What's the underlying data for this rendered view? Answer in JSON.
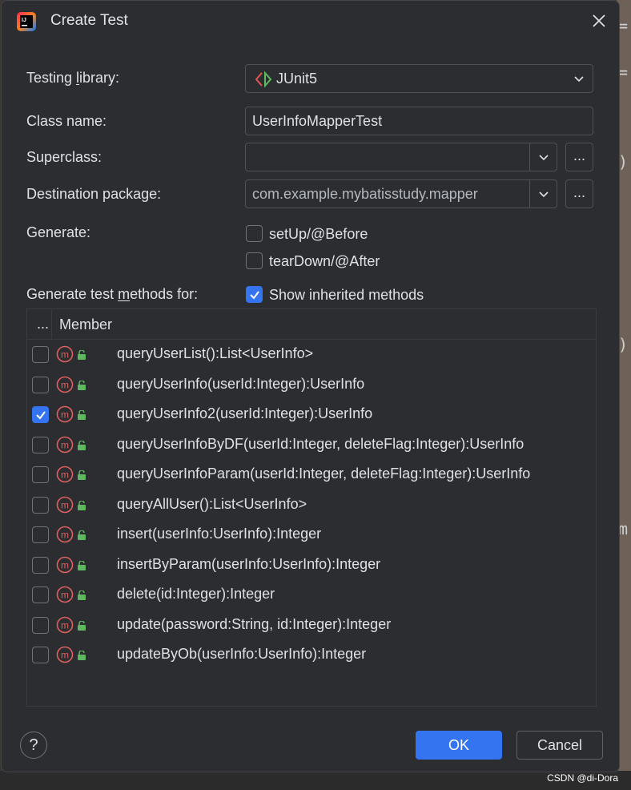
{
  "window": {
    "title": "Create Test"
  },
  "form": {
    "testing_library_label": "Testing library:",
    "testing_library_value": "JUnit5",
    "class_name_label": "Class name:",
    "class_name_value": "UserInfoMapperTest",
    "superclass_label": "Superclass:",
    "superclass_value": "",
    "destination_label": "Destination package:",
    "destination_value": "com.example.mybatisstudy.mapper",
    "browse_label": "...",
    "generate_label": "Generate:",
    "setup_label": "setUp/@Before",
    "setup_checked": false,
    "teardown_label": "tearDown/@After",
    "teardown_checked": false,
    "methods_for_label": "Generate test methods for:",
    "show_inherited_label": "Show inherited methods",
    "show_inherited_checked": true
  },
  "table": {
    "col_check": "...",
    "col_member": "Member",
    "rows": [
      {
        "signature": "queryUserList():List<UserInfo>",
        "checked": false
      },
      {
        "signature": "queryUserInfo(userId:Integer):UserInfo",
        "checked": false
      },
      {
        "signature": "queryUserInfo2(userId:Integer):UserInfo",
        "checked": true
      },
      {
        "signature": "queryUserInfoByDF(userId:Integer, deleteFlag:Integer):UserInfo",
        "checked": false
      },
      {
        "signature": "queryUserInfoParam(userId:Integer, deleteFlag:Integer):UserInfo",
        "checked": false
      },
      {
        "signature": "queryAllUser():List<UserInfo>",
        "checked": false
      },
      {
        "signature": "insert(userInfo:UserInfo):Integer",
        "checked": false
      },
      {
        "signature": "insertByParam(userInfo:UserInfo):Integer",
        "checked": false
      },
      {
        "signature": "delete(id:Integer):Integer",
        "checked": false
      },
      {
        "signature": "update(password:String, id:Integer):Integer",
        "checked": false
      },
      {
        "signature": "updateByOb(userInfo:UserInfo):Integer",
        "checked": false
      }
    ]
  },
  "buttons": {
    "help": "?",
    "ok": "OK",
    "cancel": "Cancel"
  },
  "icons": {
    "app": "intellij-idea-icon",
    "close": "close-icon",
    "method": "method-icon",
    "lock": "public-lock-icon",
    "junit": "junit-icon",
    "dropdown": "chevron-down-icon"
  },
  "colors": {
    "accent": "#3574f0",
    "method_icon": "#e06060",
    "lock_icon": "#5fb85f"
  },
  "watermark": "CSDN @di-Dora"
}
